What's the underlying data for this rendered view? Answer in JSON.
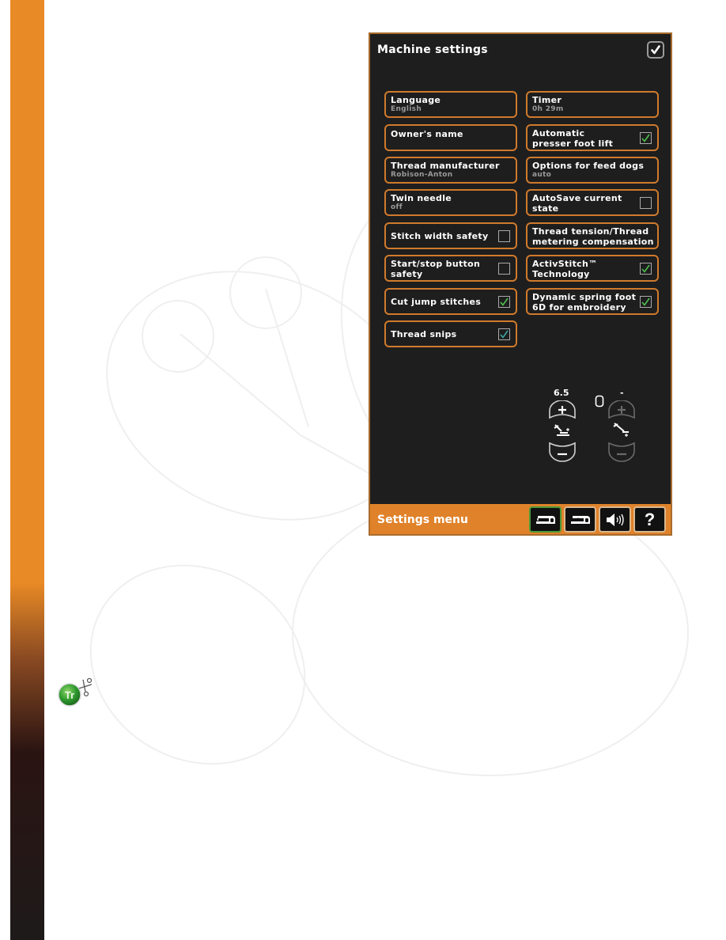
{
  "screen": {
    "title": "Machine settings",
    "confirm_icon": "checkmark-icon",
    "settings_left": [
      {
        "label": "Language",
        "value": "English",
        "checkbox": null
      },
      {
        "label": "Owner's name",
        "value": null,
        "checkbox": null
      },
      {
        "label": "Thread manufacturer",
        "value": "Robison-Anton",
        "checkbox": null
      },
      {
        "label": "Twin needle",
        "value": "off",
        "checkbox": null
      },
      {
        "label": "Stitch width safety",
        "value": null,
        "checkbox": false
      },
      {
        "label": "Start/stop button safety",
        "label_lines": [
          "Start/stop button",
          "safety"
        ],
        "value": null,
        "checkbox": false
      },
      {
        "label": "Cut jump stitches",
        "value": null,
        "checkbox": true
      },
      {
        "label": "Thread snips",
        "value": null,
        "checkbox": true
      }
    ],
    "settings_right": [
      {
        "label": "Timer",
        "value": "0h 29m",
        "checkbox": null
      },
      {
        "label": "Automatic presser foot lift",
        "label_lines": [
          "Automatic",
          "presser foot lift"
        ],
        "value": null,
        "checkbox": true
      },
      {
        "label": "Options for feed dogs",
        "value": "auto",
        "checkbox": null
      },
      {
        "label": "AutoSave current state",
        "label_lines": [
          "AutoSave current",
          "state"
        ],
        "value": null,
        "checkbox": false
      },
      {
        "label": "Thread tension/Thread metering compensation",
        "label_lines": [
          "Thread tension/Thread",
          "metering compensation"
        ],
        "value": null,
        "checkbox": null
      },
      {
        "label": "ActivStitch™ Technology",
        "label_lines": [
          "ActivStitch™",
          "Technology"
        ],
        "value": null,
        "checkbox": true
      },
      {
        "label": "Dynamic spring foot 6D for embroidery",
        "label_lines": [
          "Dynamic spring foot",
          "6D for embroidery"
        ],
        "value": null,
        "checkbox": true
      }
    ],
    "presser_foot_height": {
      "value": "6.5",
      "increase_icon": "plus-icon",
      "decrease_icon": "minus-icon",
      "icon": "presser-foot-height-icon"
    },
    "presser_foot_pressure": {
      "value": "-",
      "icon": "presser-foot-pressure-icon",
      "hoop_icon": "hoop-icon",
      "enabled": false
    },
    "bottom_bar": {
      "title": "Settings menu",
      "tabs": [
        {
          "name": "machine-settings",
          "icon": "sewing-machine-icon",
          "active": true
        },
        {
          "name": "sewing-settings",
          "icon": "sewing-machine-stitch-icon",
          "active": false
        },
        {
          "name": "sound-settings",
          "icon": "speaker-icon",
          "active": false
        },
        {
          "name": "help",
          "icon": "question-mark-icon",
          "label": "?",
          "active": false
        }
      ]
    }
  },
  "page": {
    "accent_color": "#e88a25",
    "tip_icon": "thread-trimmer-tip-icon",
    "tip_icon_label": "Tr"
  }
}
